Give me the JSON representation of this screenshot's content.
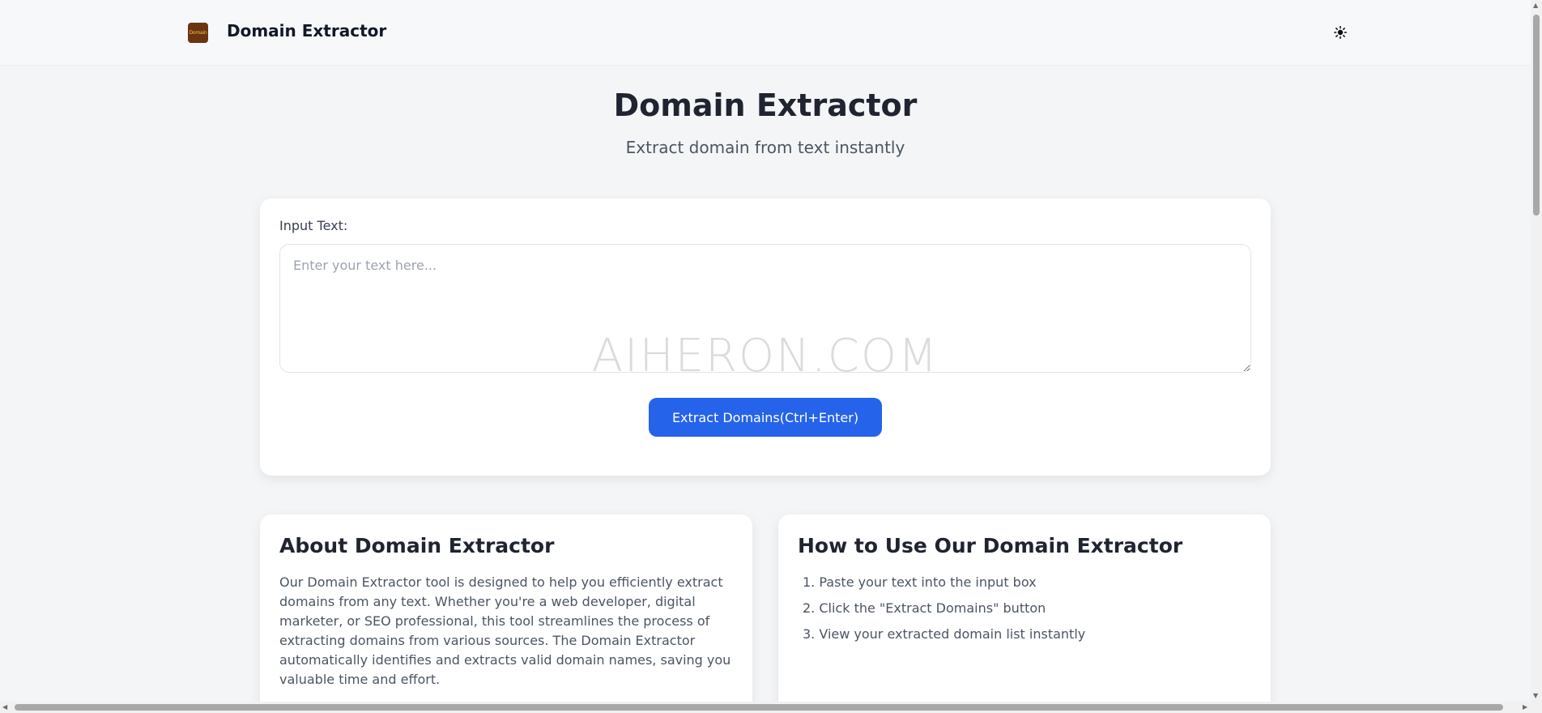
{
  "header": {
    "logo_text": "Domain",
    "brand": "Domain Extractor",
    "theme_icon": "sun-icon"
  },
  "hero": {
    "title": "Domain Extractor",
    "subtitle": "Extract domain from text instantly"
  },
  "input_section": {
    "label": "Input Text:",
    "placeholder": "Enter your text here...",
    "value": "",
    "watermark": "AIHERON.COM",
    "button_label": "Extract Domains(Ctrl+Enter)"
  },
  "about": {
    "title": "About Domain Extractor",
    "text": "Our Domain Extractor tool is designed to help you efficiently extract domains from any text. Whether you're a web developer, digital marketer, or SEO professional, this tool streamlines the process of extracting domains from various sources. The Domain Extractor automatically identifies and extracts valid domain names, saving you valuable time and effort."
  },
  "howto": {
    "title": "How to Use Our Domain Extractor",
    "steps": [
      "1. Paste your text into the input box",
      "2. Click the \"Extract Domains\" button",
      "3. View your extracted domain list instantly"
    ]
  },
  "colors": {
    "accent": "#2563eb",
    "background": "#f4f5f7",
    "logo": "#6b3410"
  }
}
